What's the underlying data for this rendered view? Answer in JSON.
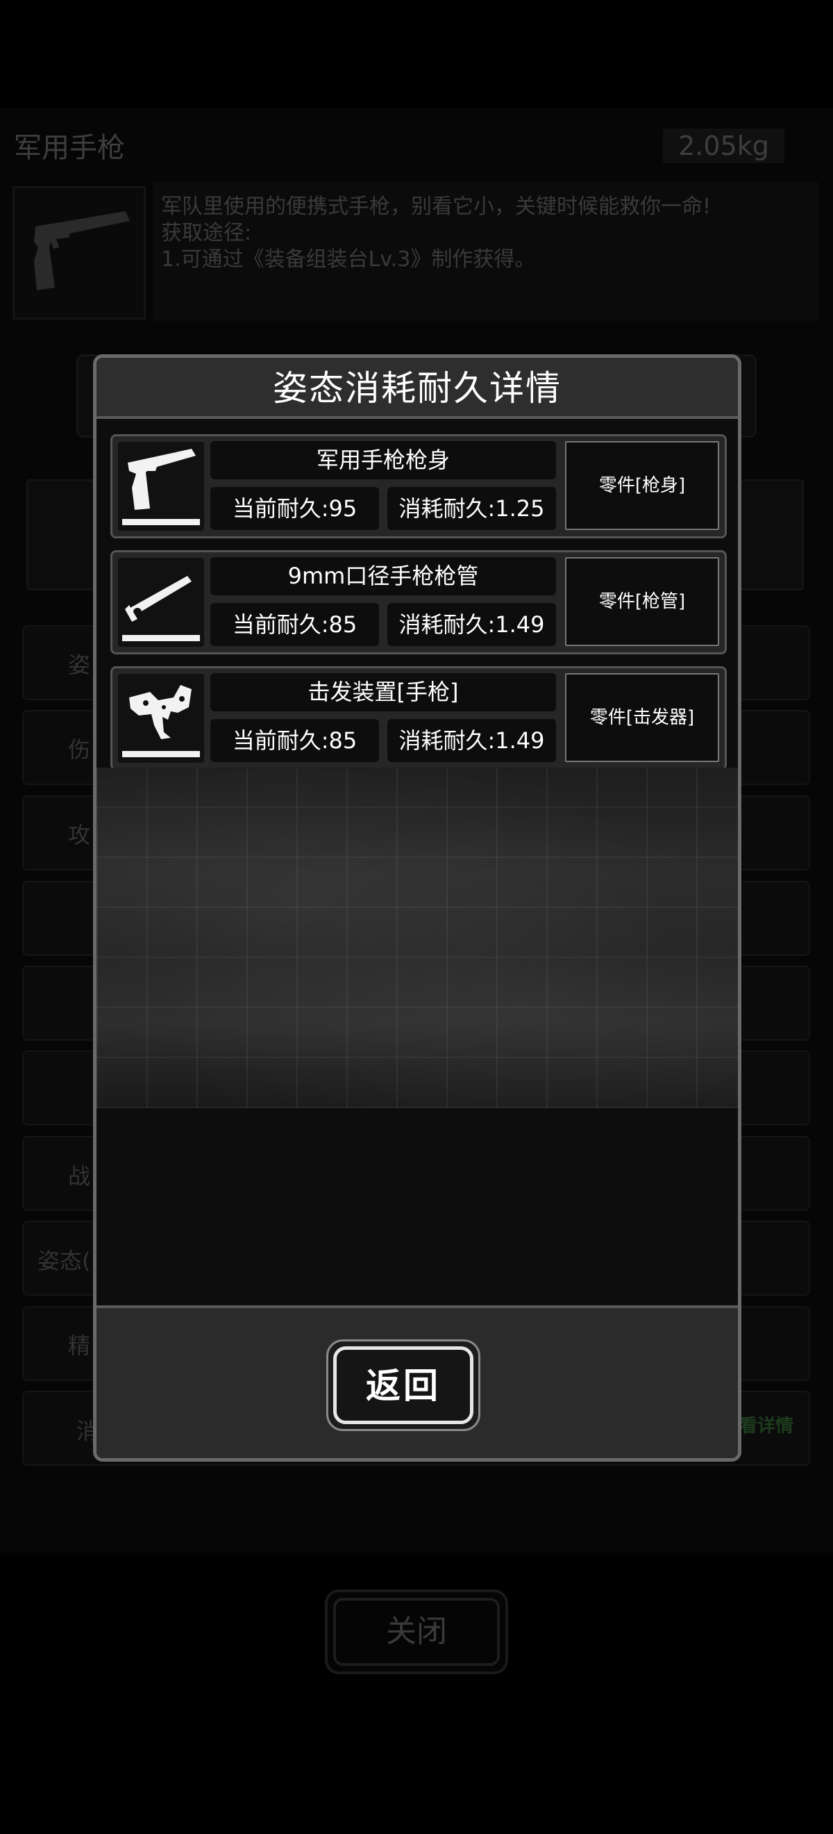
{
  "background": {
    "item_title": "军用手枪",
    "item_weight": "2.05kg",
    "description_lines": [
      "军队里使用的便携式手枪，别看它小，关键时候能救你一命!",
      "获取途径:",
      "1.可通过《装备组装台Lv.3》制作获得。"
    ],
    "row_labels": [
      "姿",
      "伤",
      "攻",
      "战",
      "姿态(",
      "精",
      "消"
    ],
    "detail_link": "看详情",
    "close_button": "关闭"
  },
  "modal": {
    "title": "姿态消耗耐久详情",
    "back_button": "返回",
    "parts": [
      {
        "name": "军用手枪枪身",
        "current": "当前耐久:95",
        "consume": "消耗耐久:1.25",
        "type": "零件[枪身]",
        "icon": "pistol-frame-icon"
      },
      {
        "name": "9mm口径手枪枪管",
        "current": "当前耐久:85",
        "consume": "消耗耐久:1.49",
        "type": "零件[枪管]",
        "icon": "pistol-barrel-icon"
      },
      {
        "name": "击发装置[手枪]",
        "current": "当前耐久:85",
        "consume": "消耗耐久:1.49",
        "type": "零件[击发器]",
        "icon": "trigger-assembly-icon"
      }
    ]
  },
  "colors": {
    "modal_border": "#6a6a6a",
    "header_bg": "#2e2e2e",
    "row_bg": "#262626",
    "text": "#ffffff"
  }
}
